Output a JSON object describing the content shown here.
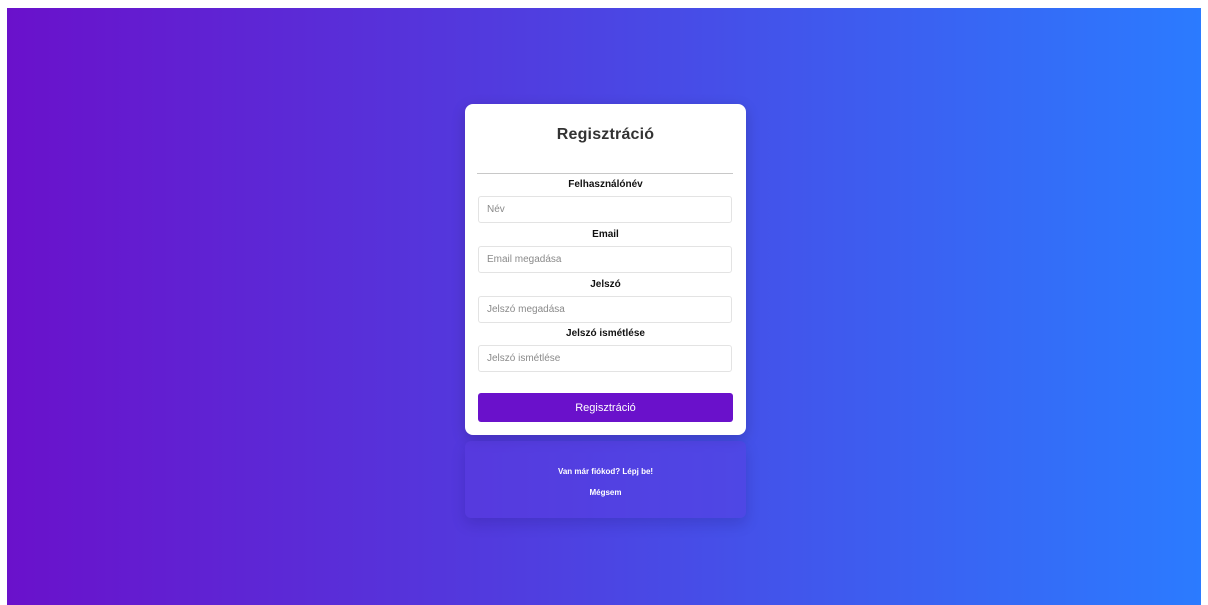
{
  "form": {
    "title": "Regisztráció",
    "fields": [
      {
        "label": "Felhasználónév",
        "placeholder": "Név",
        "value": ""
      },
      {
        "label": "Email",
        "placeholder": "Email megadása",
        "value": ""
      },
      {
        "label": "Jelszó",
        "placeholder": "Jelszó megadása",
        "value": ""
      },
      {
        "label": "Jelszó ismétlése",
        "placeholder": "Jelszó ismétlése",
        "value": ""
      }
    ],
    "submit_label": "Regisztráció"
  },
  "footer": {
    "login_link": "Van már fiókod? Lépj be!",
    "cancel_link": "Mégsem"
  },
  "colors": {
    "gradient_start": "#6a11cb",
    "gradient_end": "#2b7bff",
    "button": "#6a11cb",
    "card": "#ffffff"
  }
}
